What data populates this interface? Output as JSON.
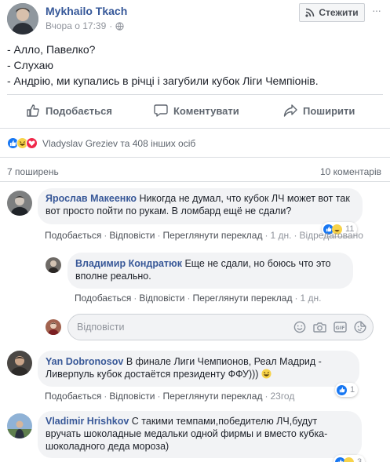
{
  "post": {
    "author": "Mykhailo Tkach",
    "time": "Вчора о 17:39",
    "time_sep": "·",
    "follow_label": "Стежити",
    "text_lines": [
      "- Алло, Павелко?",
      "- Слухаю",
      "- Андрію, ми купались в річці і загубили кубок Ліги Чемпіонів."
    ]
  },
  "actions": {
    "like": "Подобається",
    "comment": "Коментувати",
    "share": "Поширити"
  },
  "reactions": {
    "summary": "Vladyslav Greziev та 408 інших осіб"
  },
  "stats": {
    "shares": "7 поширень",
    "comments": "10 коментарів"
  },
  "comments": [
    {
      "author": "Ярослав Макеенко",
      "text": "Никогда не думал, что кубок ЛЧ может вот так вот просто пойти по рукам. В ломбард ещё не сдали?",
      "like": "Подобається",
      "reply": "Відповісти",
      "translate": "Переглянути переклад",
      "time": "1 дн.",
      "edited": "Відредаговано",
      "reactions_count": "11"
    },
    {
      "author": "Владимир Кондратюк",
      "text": "Еще не сдали, но боюсь что это вполне реально.",
      "like": "Подобається",
      "reply": "Відповісти",
      "translate": "Переглянути переклад",
      "time": "1 дн."
    },
    {
      "author": "Yan Dobronosov",
      "text": "В финале Лиги Чемпионов, Реал Мадрид - Ливерпуль кубок достаётся президенту ФФУ)))",
      "like": "Подобається",
      "reply": "Відповісти",
      "translate": "Переглянути переклад",
      "time": "23год",
      "reactions_count": "1"
    },
    {
      "author": "Vladimir Hrishkov",
      "text": "С такими темпами,победителю ЛЧ,будут вручать шоколадные медальки одной фирмы и вместо кубка-шоколадного деда мороза)",
      "reactions_count": "3"
    }
  ],
  "reply_box": {
    "placeholder": "Відповісти"
  },
  "icons": {
    "follow": "rss-feed-icon",
    "audience": "globe-icon",
    "like": "thumbs-up-icon",
    "comment": "speech-bubble-icon",
    "share": "share-arrow-icon",
    "emoji": "smiley-icon",
    "camera": "camera-icon",
    "gif": "gif-icon",
    "sticker": "sticker-icon"
  },
  "colors": {
    "link": "#385898",
    "like_blue": "#1877f2",
    "haha_yellow": "#f7d34a",
    "love_red": "#f0284a",
    "bubble_bg": "#f2f3f5",
    "meta_gray": "#90949c"
  }
}
